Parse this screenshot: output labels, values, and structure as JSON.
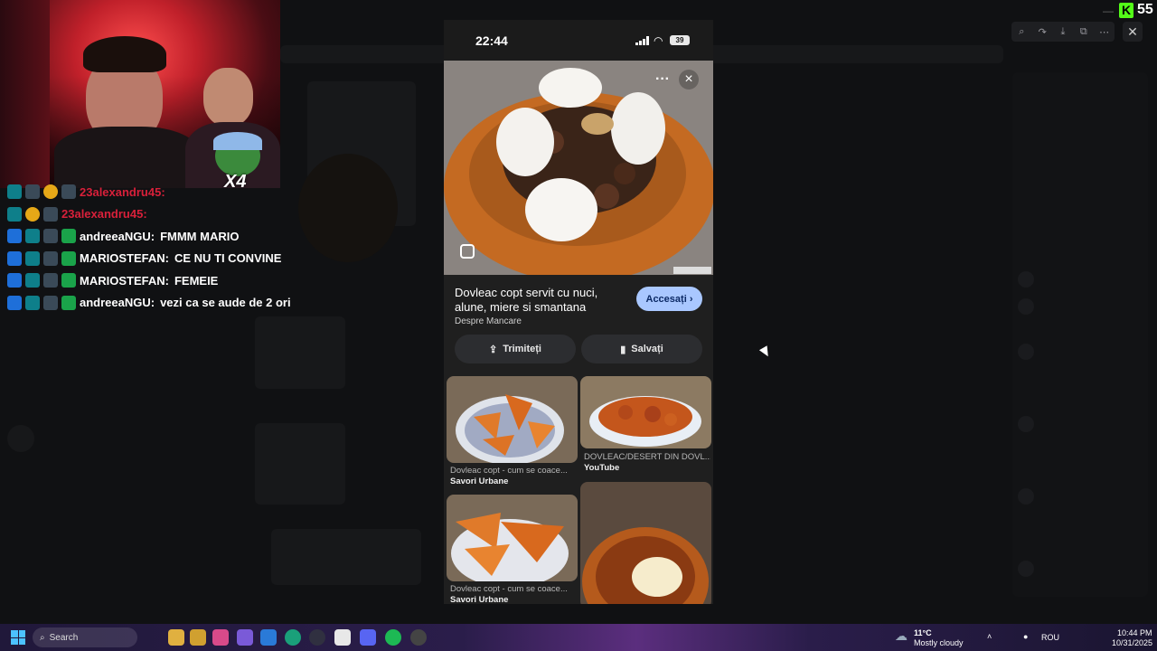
{
  "stream": {
    "platform_logo": "K",
    "viewer_count": "55"
  },
  "chat": [
    {
      "user": "23alexandru45:",
      "message": "",
      "user_color": "#d8203a",
      "badges": [
        "cyan",
        "gray",
        "gold",
        "gray"
      ]
    },
    {
      "user": "23alexandru45:",
      "message": "",
      "user_color": "#d8203a",
      "badges": [
        "cyan",
        "gold",
        "gray"
      ]
    },
    {
      "user": "andreeaNGU:",
      "message": "FMMM MARIO",
      "user_color": "#ffffff",
      "badges": [
        "blue",
        "cyan",
        "gray",
        "green"
      ]
    },
    {
      "user": "MARIOSTEFAN:",
      "message": "CE NU TI CONVINE",
      "user_color": "#ffffff",
      "badges": [
        "blue",
        "cyan",
        "gray",
        "green"
      ]
    },
    {
      "user": "MARIOSTEFAN:",
      "message": "FEMEIE",
      "user_color": "#ffffff",
      "badges": [
        "blue",
        "cyan",
        "gray",
        "green"
      ]
    },
    {
      "user": "andreeaNGU:",
      "message": "vezi ca se aude de 2 ori",
      "user_color": "#ffffff",
      "badges": [
        "blue",
        "cyan",
        "gray",
        "green"
      ]
    }
  ],
  "webcam": {
    "overlay_text": "X4"
  },
  "phone": {
    "time": "22:44",
    "battery": "39",
    "pin": {
      "title": "Dovleac copt servit cu nuci, alune, miere si smantana",
      "source": "Despre Mancare",
      "visit_label": "Accesați",
      "share_label": "Trimiteți",
      "save_label": "Salvați"
    },
    "grid": [
      {
        "caption": "Dovleac copt - cum se coace...",
        "source": "Savori Urbane"
      },
      {
        "caption": "DOVLEAC/DESERT DIN DOVL...",
        "source": "YouTube"
      },
      {
        "caption": "Dovleac copt - cum se coace...",
        "source": "Savori Urbane"
      },
      {
        "caption": "",
        "source": ""
      }
    ]
  },
  "viewer": {
    "toolbar_icons": [
      "zoom-icon",
      "forward-icon",
      "download-icon",
      "open-external-icon",
      "more-icon"
    ],
    "close_icon": "close-icon"
  },
  "taskbar": {
    "search_label": "Search",
    "weather_temp": "11°C",
    "weather_text": "Mostly cloudy",
    "language": "ROU",
    "time": "10:44 PM",
    "date": "10/31/2025"
  },
  "colors": {
    "accent_kick": "#53fc18",
    "visit_button": "#a9c7ff",
    "chat_red": "#d8203a"
  }
}
